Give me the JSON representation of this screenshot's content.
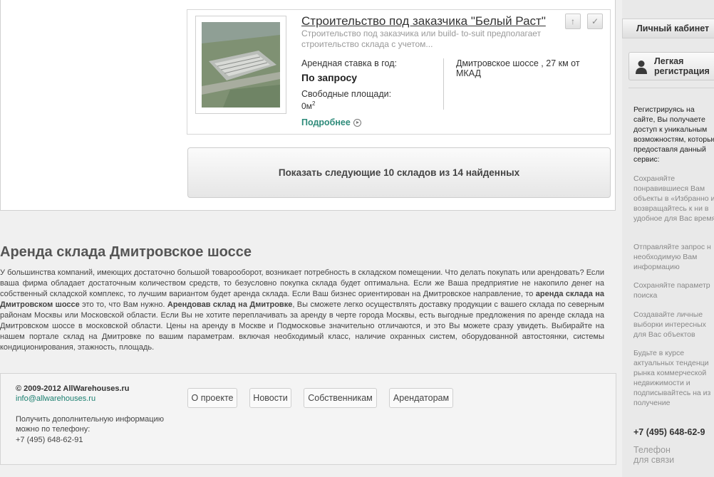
{
  "listing": {
    "title": "Строительство под заказчика \"Белый Раст\"",
    "description": "Строительство под заказчика или build- to-suit предполагает строительство склада с учетом...",
    "rate_label": "Арендная ставка в год:",
    "rate_value": "По запросу",
    "free_area_label": "Свободные площади:",
    "free_area_value": "0м",
    "free_area_unit_sup": "2",
    "address": "Дмитровское шоссе , 27 км от МКАД",
    "more_label": "Подробнее",
    "up_icon": "↑",
    "check_icon": "✓"
  },
  "show_more_label": "Показать следующие 10 складов из 14 найденных",
  "seo": {
    "title": "Аренда склада Дмитровское шоссе",
    "p1": "У большинства компаний, имеющих достаточно большой товарооборот, возникает потребность в складском помещении. Что делать покупать или арендовать? Если ваша фирма обладает достаточным количеством средств, то безусловно покупка склада будет оптимальна. Если же Ваша предприятие не накопило денег на собственный складской комплекс, то лучшим вариантом будет аренда склада. Если Ваш бизнес ориентирован на Дмитровское направление, то ",
    "b1": "аренда склада на Дмитровском шоссе",
    "p2": " это то, что Вам нужно. ",
    "b2": "Арендовав склад на Дмитровке",
    "p3": ", Вы сможете легко осуществлять доставку продукции с вашего склада по северным районам Москвы или Московской области. Если Вы не хотите переплачивать за аренду в черте города Москвы, есть выгодные предложения по аренде склада на Дмитровском шоссе в московской области. Цены на аренду в Москве и Подмосковье значительно отличаются, и это Вы можете сразу увидеть. Выбирайте на нашем портале склад на Дмитровке по вашим параметрам. включая необходимый класс, наличие охранных систем, оборудованной автостоянки, системы кондиционирования, этажность, площадь."
  },
  "footer": {
    "copyright": "© 2009-2012 AllWarehouses.ru",
    "email": "info@allwarehouses.ru",
    "phone_note": "Получить дополнительную информацию можно по телефону:",
    "phone": "+7 (495) 648-62-91",
    "nav": [
      "О проекте",
      "Новости",
      "Собственникам",
      "Арендаторам"
    ]
  },
  "sidebar": {
    "tab_label": "Личный кабинет",
    "register_label": "Легкая регистрация",
    "intro": "Регистрируясь на сайте, Вы получаете доступ к уникальным возможностям, которые предоставля данный сервис:",
    "benefits": [
      "Сохраняйте понравившиеся Вам объекты в «Избранно и возвращайтесь к ни в удобное для Вас время",
      "Отправляйте запрос н необходимую Вам информацию",
      "Сохраняйте параметр поиска",
      "Создавайте личные выборки интересных для Вас объектов",
      "Будьте в курсе актуальных тенденци рынка коммерческой недвижимости и подписывайтесь на из получение"
    ],
    "phone": "+7 (495) 648-62-9",
    "phone_label": "Телефон для связи"
  },
  "colors": {
    "accent_link": "#2e8b7a",
    "email_link": "#1a7f6f"
  }
}
